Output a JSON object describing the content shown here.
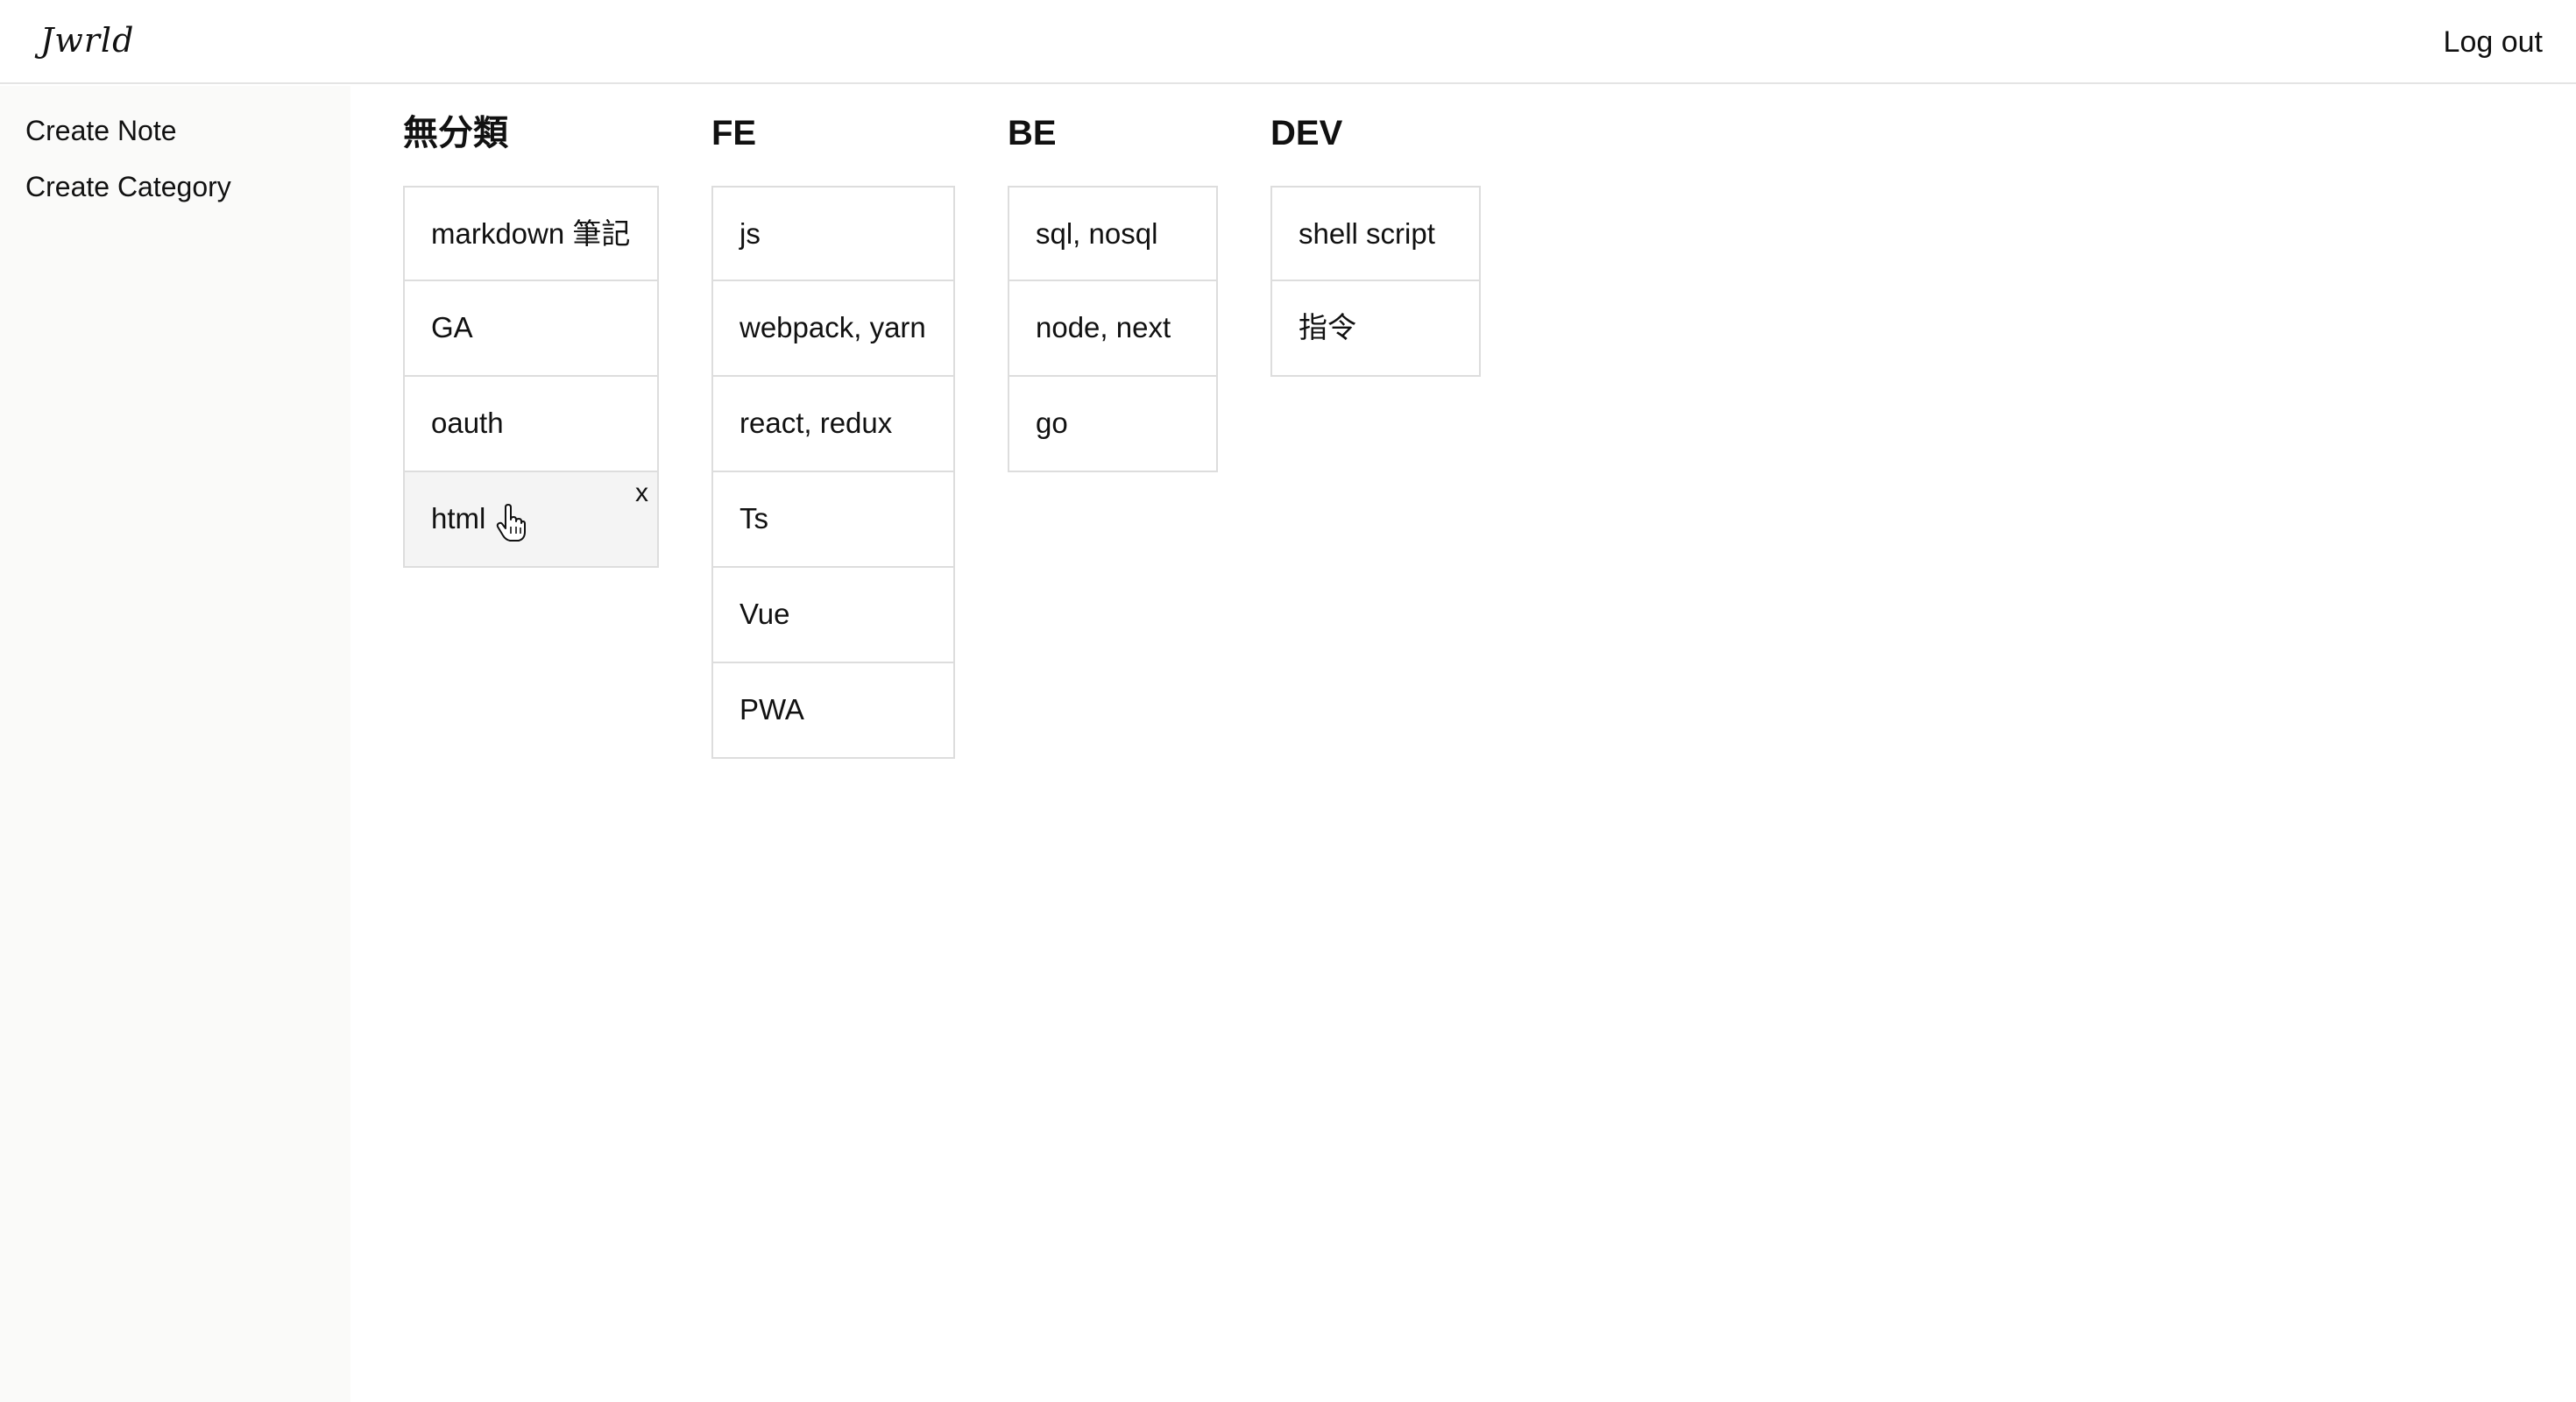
{
  "header": {
    "logo": "Jwrld",
    "logout_label": "Log out"
  },
  "sidebar": {
    "items": [
      {
        "label": "Create Note"
      },
      {
        "label": "Create Category"
      }
    ]
  },
  "columns": [
    {
      "title": "無分類",
      "notes": [
        "markdown 筆記",
        "GA",
        "oauth",
        "html"
      ]
    },
    {
      "title": "FE",
      "notes": [
        "js",
        "webpack, yarn",
        "react, redux",
        "Ts",
        "Vue",
        "PWA"
      ]
    },
    {
      "title": "BE",
      "notes": [
        "sql, nosql",
        "node, next",
        "go"
      ]
    },
    {
      "title": "DEV",
      "notes": [
        "shell script",
        "指令"
      ]
    }
  ],
  "hovered_note": {
    "column": 0,
    "index": 3,
    "delete_label": "x"
  }
}
